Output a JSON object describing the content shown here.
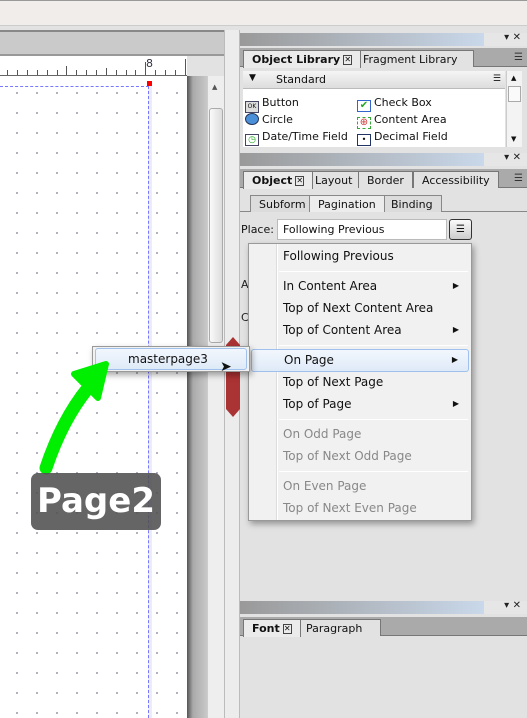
{
  "ruler": {
    "label": "8"
  },
  "object_library": {
    "tabs": [
      {
        "label": "Object Library",
        "active": true
      },
      {
        "label": "Fragment Library",
        "active": false
      }
    ],
    "category": "Standard",
    "items": [
      {
        "label": "Button",
        "icon": "button-icon"
      },
      {
        "label": "Check Box",
        "icon": "check-box-icon"
      },
      {
        "label": "Circle",
        "icon": "circle-icon"
      },
      {
        "label": "Content Area",
        "icon": "content-area-icon"
      },
      {
        "label": "Date/Time Field",
        "icon": "date-time-icon"
      },
      {
        "label": "Decimal Field",
        "icon": "decimal-field-icon"
      }
    ]
  },
  "object_panel": {
    "tabs": [
      {
        "label": "Object",
        "active": true
      },
      {
        "label": "Layout"
      },
      {
        "label": "Border"
      },
      {
        "label": "Accessibility"
      }
    ],
    "subtabs": [
      {
        "label": "Subform"
      },
      {
        "label": "Pagination",
        "active": true
      },
      {
        "label": "Binding"
      }
    ],
    "place_label": "Place:",
    "place_value": "Following Previous",
    "hidden_labels": [
      "A",
      "C"
    ]
  },
  "place_menu": {
    "items": [
      {
        "label": "Following Previous",
        "enabled": true,
        "submenu": false
      },
      {
        "label": "In Content Area",
        "enabled": true,
        "submenu": true
      },
      {
        "label": "Top of Next Content Area",
        "enabled": true,
        "submenu": false
      },
      {
        "label": "Top of Content Area",
        "enabled": true,
        "submenu": true
      },
      {
        "label": "On Page",
        "enabled": true,
        "submenu": true,
        "highlighted": true
      },
      {
        "label": "Top of Next Page",
        "enabled": true,
        "submenu": false
      },
      {
        "label": "Top of Page",
        "enabled": true,
        "submenu": true
      },
      {
        "label": "On Odd Page",
        "enabled": false
      },
      {
        "label": "Top of Next Odd Page",
        "enabled": false
      },
      {
        "label": "On Even Page",
        "enabled": false
      },
      {
        "label": "Top of Next Even Page",
        "enabled": false
      }
    ]
  },
  "submenu": {
    "items": [
      {
        "label": "masterpage3",
        "highlighted": true
      }
    ]
  },
  "font_panel": {
    "tabs": [
      {
        "label": "Font",
        "active": true
      },
      {
        "label": "Paragraph"
      }
    ]
  },
  "annotation": {
    "label": "Page2",
    "arrow_color": "#00ee00"
  },
  "colors": {
    "menu_highlight_border": "#9fc1ec",
    "guide": "#7777ff",
    "handle": "#ff0000"
  }
}
